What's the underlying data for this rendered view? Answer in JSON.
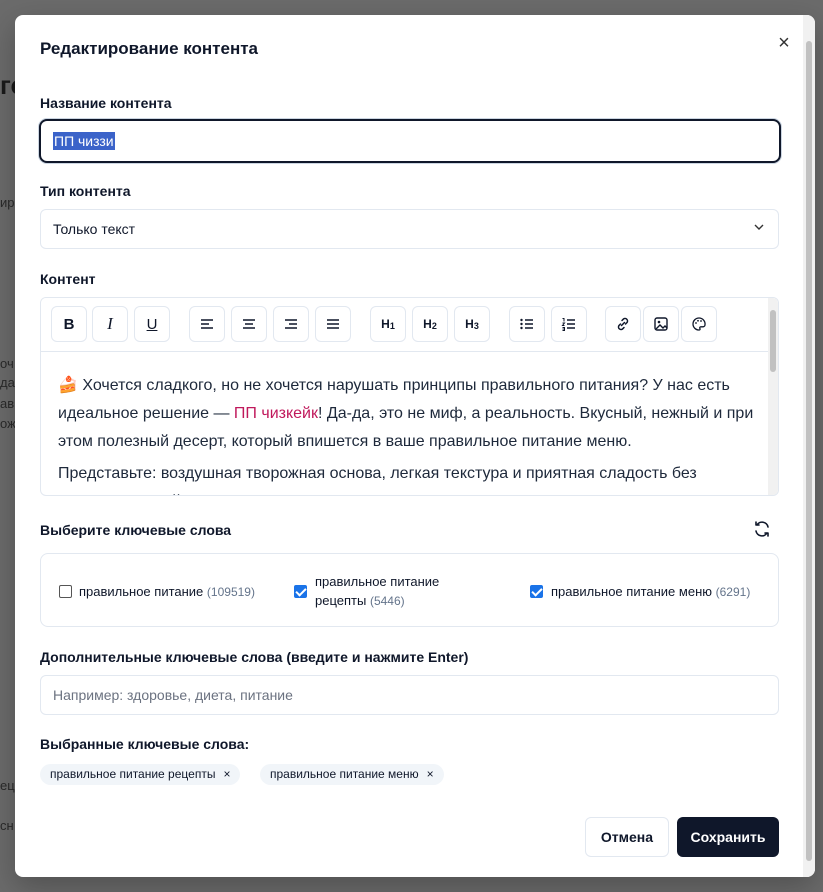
{
  "dialog": {
    "title": "Редактирование контента",
    "close": "×"
  },
  "name_field": {
    "label": "Название контента",
    "value": "ПП чиззи"
  },
  "type_field": {
    "label": "Тип контента",
    "value": "Только текст"
  },
  "content": {
    "label": "Контент",
    "toolbar": {
      "bold": "B",
      "italic": "I",
      "underline": "U",
      "h1": "H",
      "h1_sub": "1",
      "h2": "H",
      "h2_sub": "2",
      "h3": "H",
      "h3_sub": "3"
    },
    "paragraph1": {
      "emoji": "🍰",
      "before_link": " Хочется сладкого, но не хочется нарушать принципы правильного питания? У нас есть идеальное решение — ",
      "link": "ПП чизкейк",
      "after_link": "! Да-да, это не миф, а реальность. Вкусный, нежный и при этом полезный десерт, который впишется в ваше правильное питание меню."
    },
    "paragraph2": "Представьте: воздушная творожная основа, легкая текстура и приятная сладость без лишних калорий. А"
  },
  "keywords": {
    "label": "Выберите ключевые слова",
    "items": [
      {
        "text": "правильное питание",
        "count": "(109519)",
        "checked": false
      },
      {
        "text_line1": "правильное питание",
        "text_line2": "рецепты",
        "count": "(5446)",
        "checked": true
      },
      {
        "text": "правильное питание меню",
        "count": "(6291)",
        "checked": true
      }
    ]
  },
  "extra_keywords": {
    "label": "Дополнительные ключевые слова (введите и нажмите Enter)",
    "placeholder": "Например: здоровье, диета, питание"
  },
  "selected_keywords": {
    "label": "Выбранные ключевые слова:",
    "chips": [
      {
        "text": "правильное питание рецепты",
        "remove": "×"
      },
      {
        "text": "правильное питание меню",
        "remove": "×"
      }
    ]
  },
  "buttons": {
    "cancel": "Отмена",
    "save": "Сохранить"
  },
  "background": {
    "fragments": [
      "го",
      "ир",
      "оч",
      "да,",
      "ав",
      "ож",
      "ец",
      "сн"
    ]
  }
}
